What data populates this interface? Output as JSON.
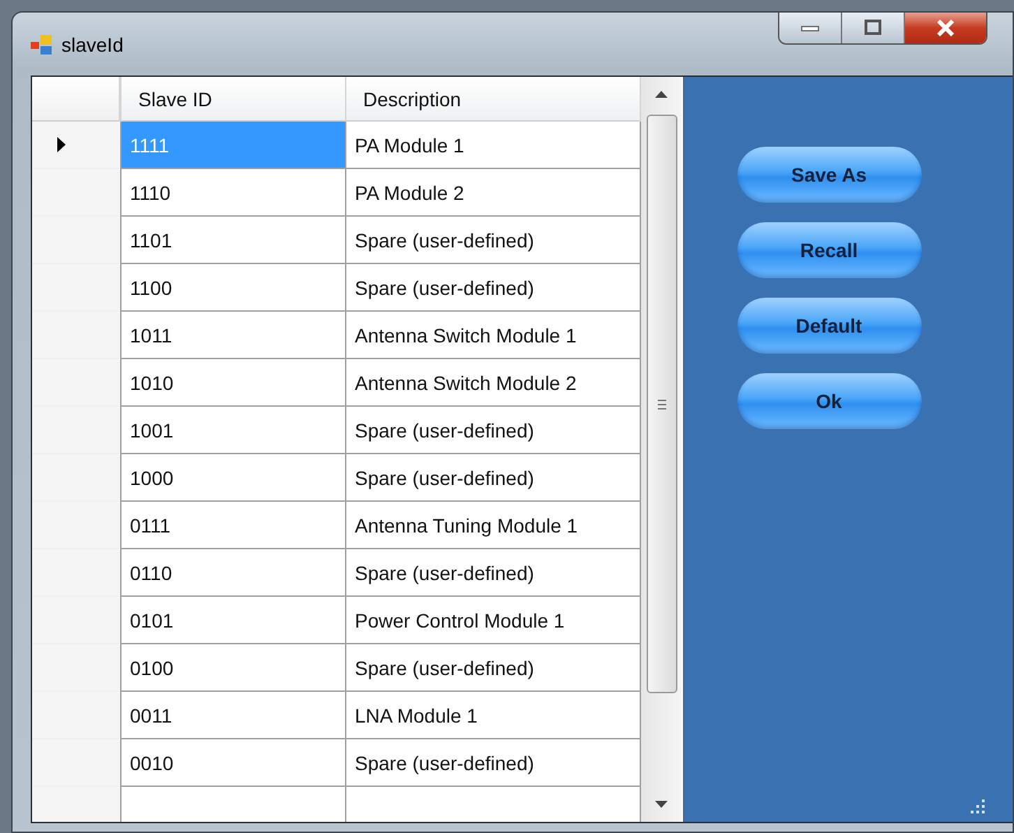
{
  "window": {
    "title": "slaveId"
  },
  "table": {
    "columns": [
      "Slave ID",
      "Description"
    ],
    "rows": [
      {
        "cells": [
          "1111",
          "PA Module 1"
        ],
        "selected": true
      },
      {
        "cells": [
          "1110",
          "PA Module 2"
        ],
        "selected": false
      },
      {
        "cells": [
          "1101",
          "Spare (user-defined)"
        ],
        "selected": false
      },
      {
        "cells": [
          "1100",
          "Spare (user-defined)"
        ],
        "selected": false
      },
      {
        "cells": [
          "1011",
          "Antenna Switch Module 1"
        ],
        "selected": false
      },
      {
        "cells": [
          "1010",
          "Antenna Switch Module 2"
        ],
        "selected": false
      },
      {
        "cells": [
          "1001",
          "Spare (user-defined)"
        ],
        "selected": false
      },
      {
        "cells": [
          "1000",
          "Spare (user-defined)"
        ],
        "selected": false
      },
      {
        "cells": [
          "0111",
          "Antenna Tuning Module 1"
        ],
        "selected": false
      },
      {
        "cells": [
          "0110",
          "Spare (user-defined)"
        ],
        "selected": false
      },
      {
        "cells": [
          "0101",
          "Power Control Module 1"
        ],
        "selected": false
      },
      {
        "cells": [
          "0100",
          "Spare (user-defined)"
        ],
        "selected": false
      },
      {
        "cells": [
          "0011",
          "LNA Module 1"
        ],
        "selected": false
      },
      {
        "cells": [
          "0010",
          "Spare (user-defined)"
        ],
        "selected": false
      }
    ]
  },
  "buttons": [
    "Save As",
    "Recall",
    "Default",
    "Ok"
  ]
}
